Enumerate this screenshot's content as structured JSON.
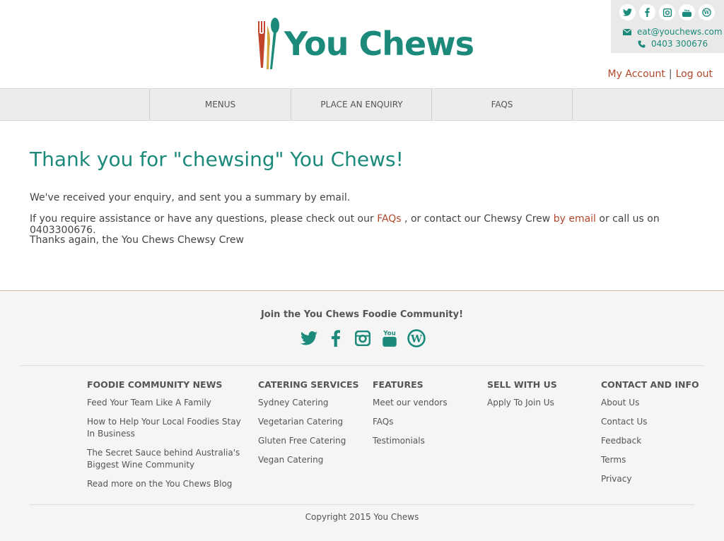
{
  "brand": {
    "name": "You Chews",
    "accent": "#1b8a7a",
    "link_color": "#b1482c"
  },
  "header": {
    "social_icons": [
      "twitter-icon",
      "facebook-icon",
      "instagram-icon",
      "youtube-icon",
      "wordpress-icon"
    ],
    "email": "eat@youchews.com",
    "phone": "0403 300676",
    "my_account": "My Account",
    "separator": "|",
    "log_out": "Log out"
  },
  "nav": {
    "items": [
      {
        "label": "MENUS"
      },
      {
        "label": "PLACE AN ENQUIRY"
      },
      {
        "label": "FAQS"
      }
    ]
  },
  "main": {
    "title": "Thank you for \"chewsing\" You Chews!",
    "line1": "We've received your enquiry, and sent you a summary by email.",
    "line2_prefix": "If you require assistance or have any questions, please check out our ",
    "line2_faqs": "FAQs",
    "line2_middle": " , or contact our Chewsy Crew ",
    "line2_email": "by email",
    "line2_suffix": " or call us on 0403300676.",
    "line3": "Thanks again, the You Chews Chewsy Crew"
  },
  "footer": {
    "join": "Join the You Chews Foodie Community!",
    "columns": [
      {
        "title": "FOODIE COMMUNITY NEWS",
        "items": [
          "Feed Your Team Like A Family",
          "How to Help Your Local Foodies Stay In Business",
          "The Secret Sauce behind Australia's Biggest Wine Community",
          "Read more on the You Chews Blog"
        ]
      },
      {
        "title": "CATERING SERVICES",
        "items": [
          "Sydney Catering",
          "Vegetarian Catering",
          "Gluten Free Catering",
          "Vegan Catering"
        ]
      },
      {
        "title": "FEATURES",
        "items": [
          "Meet our vendors",
          "FAQs",
          "Testimonials"
        ]
      },
      {
        "title": "SELL WITH US",
        "items": [
          "Apply To Join Us"
        ]
      },
      {
        "title": "CONTACT AND INFO",
        "items": [
          "About Us",
          "Contact Us",
          "Feedback",
          "Terms",
          "Privacy"
        ]
      }
    ],
    "copyright": "Copyright 2015 You Chews"
  }
}
